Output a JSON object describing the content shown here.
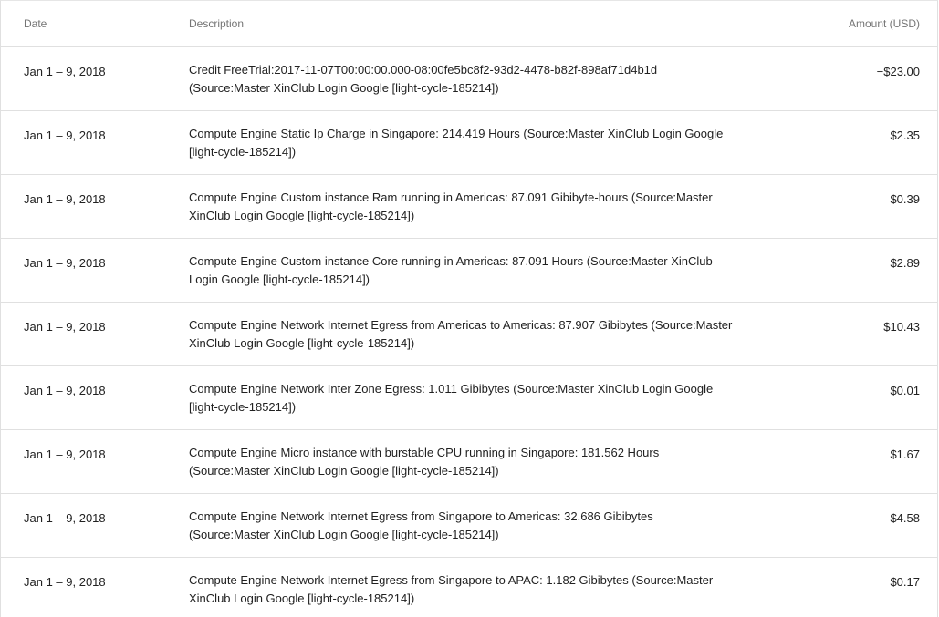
{
  "header": {
    "date": "Date",
    "description": "Description",
    "amount": "Amount (USD)"
  },
  "rows": [
    {
      "date": "Jan 1 – 9, 2018",
      "description": "Credit FreeTrial:2017-11-07T00:00:00.000-08:00fe5bc8f2-93d2-4478-b82f-898af71d4b1d (Source:Master XinClub Login Google [light-cycle-185214])",
      "amount": "−$23.00"
    },
    {
      "date": "Jan 1 – 9, 2018",
      "description": "Compute Engine Static Ip Charge in Singapore: 214.419 Hours (Source:Master XinClub Login Google [light-cycle-185214])",
      "amount": "$2.35"
    },
    {
      "date": "Jan 1 – 9, 2018",
      "description": "Compute Engine Custom instance Ram running in Americas: 87.091 Gibibyte-hours (Source:Master XinClub Login Google [light-cycle-185214])",
      "amount": "$0.39"
    },
    {
      "date": "Jan 1 – 9, 2018",
      "description": "Compute Engine Custom instance Core running in Americas: 87.091 Hours (Source:Master XinClub Login Google [light-cycle-185214])",
      "amount": "$2.89"
    },
    {
      "date": "Jan 1 – 9, 2018",
      "description": "Compute Engine Network Internet Egress from Americas to Americas: 87.907 Gibibytes (Source:Master XinClub Login Google [light-cycle-185214])",
      "amount": "$10.43"
    },
    {
      "date": "Jan 1 – 9, 2018",
      "description": "Compute Engine Network Inter Zone Egress: 1.011 Gibibytes (Source:Master XinClub Login Google [light-cycle-185214])",
      "amount": "$0.01"
    },
    {
      "date": "Jan 1 – 9, 2018",
      "description": "Compute Engine Micro instance with burstable CPU running in Singapore: 181.562 Hours (Source:Master XinClub Login Google [light-cycle-185214])",
      "amount": "$1.67"
    },
    {
      "date": "Jan 1 – 9, 2018",
      "description": "Compute Engine Network Internet Egress from Singapore to Americas: 32.686 Gibibytes (Source:Master XinClub Login Google [light-cycle-185214])",
      "amount": "$4.58"
    },
    {
      "date": "Jan 1 – 9, 2018",
      "description": "Compute Engine Network Internet Egress from Singapore to APAC: 1.182 Gibibytes (Source:Master XinClub Login Google [light-cycle-185214])",
      "amount": "$0.17"
    }
  ]
}
